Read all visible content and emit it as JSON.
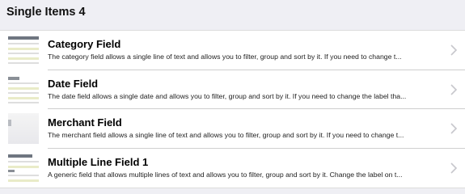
{
  "header": {
    "title": "Single Items 4"
  },
  "items": [
    {
      "title": "Category Field",
      "description": "The category field allows a single line of text and allows you to filter, group and sort by it. If you need to change t..."
    },
    {
      "title": "Date Field",
      "description": "The date field allows a single date and allows you to filter, group and sort by it. If you need to change the label tha..."
    },
    {
      "title": "Merchant Field",
      "description": "The merchant field allows a single line of text and allows you to filter, group and sort by it. If you need to change t..."
    },
    {
      "title": "Multiple Line Field 1",
      "description": "A generic field that allows multiple lines of text and allows you to filter, group and sort by it. Change the label on t..."
    }
  ],
  "icons": {
    "disclosure": "chevron-right-icon",
    "thumbnail": "field-preview-thumbnail"
  },
  "colors": {
    "background": "#efeff4",
    "row": "#ffffff",
    "chevron": "#c7c7cc"
  }
}
